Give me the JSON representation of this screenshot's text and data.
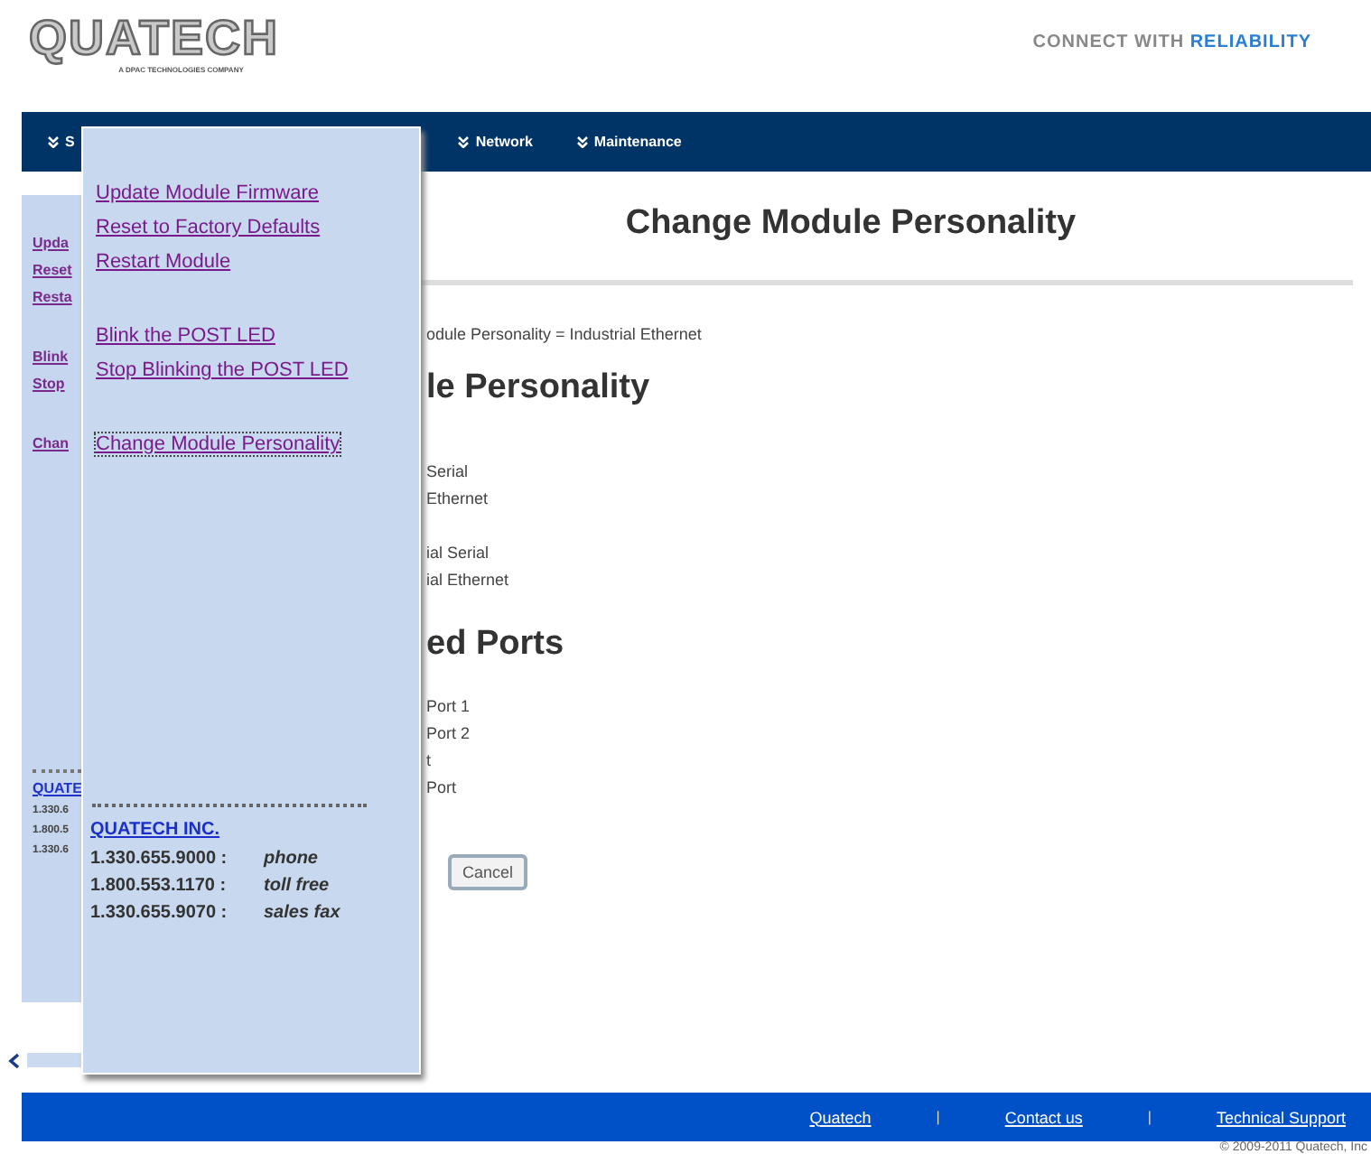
{
  "header": {
    "logo": "QUATECH",
    "logo_subtitle": "A DPAC TECHNOLOGIES COMPANY",
    "tagline": "CONNECT WITH",
    "tagline_emphasis": "RELIABILITY"
  },
  "nav": [
    {
      "label": "S"
    },
    {
      "label": "Network"
    },
    {
      "label": "Maintenance"
    }
  ],
  "sidebar": {
    "groups": [
      [
        "Upda",
        "Reset",
        "Resta"
      ],
      [
        "Blink",
        "Stop"
      ],
      [
        "Chan"
      ]
    ],
    "company": "QUATE",
    "phones": [
      "1.330.6",
      "1.800.5",
      "1.330.6"
    ]
  },
  "popup": {
    "groups": [
      [
        {
          "label": "Update Module Firmware",
          "focused": false
        },
        {
          "label": "Reset to Factory Defaults",
          "focused": false
        },
        {
          "label": "Restart Module",
          "focused": false
        }
      ],
      [
        {
          "label": "Blink the POST LED",
          "focused": false
        },
        {
          "label": "Stop Blinking the POST LED",
          "focused": false
        }
      ],
      [
        {
          "label": "Change Module Personality",
          "focused": true
        }
      ]
    ],
    "company": "QUATECH INC.",
    "contacts": [
      {
        "number": "1.330.655.9000 :",
        "label": "phone"
      },
      {
        "number": "1.800.553.1170 :",
        "label": "toll free"
      },
      {
        "number": "1.330.655.9070 :",
        "label": "sales fax"
      }
    ]
  },
  "main": {
    "title": "Change Module Personality",
    "status": "odule Personality = Industrial Ethernet",
    "section_1": "le Personality",
    "options": [
      [
        "Serial",
        "Ethernet"
      ],
      [
        "ial Serial",
        "ial Ethernet"
      ]
    ],
    "section_2": "ed Ports",
    "ports": [
      "Port 1",
      "Port 2",
      "t",
      "Port"
    ],
    "button": "Cancel"
  },
  "footer": {
    "links": [
      {
        "kind": "link",
        "text": "Quatech"
      },
      {
        "kind": "separator",
        "text": "|"
      },
      {
        "kind": "link",
        "text": "Contact us"
      },
      {
        "kind": "separator",
        "text": "|"
      },
      {
        "kind": "link",
        "text": "Technical Support"
      }
    ],
    "copyright": "© 2009-2011 Quatech, Inc"
  }
}
